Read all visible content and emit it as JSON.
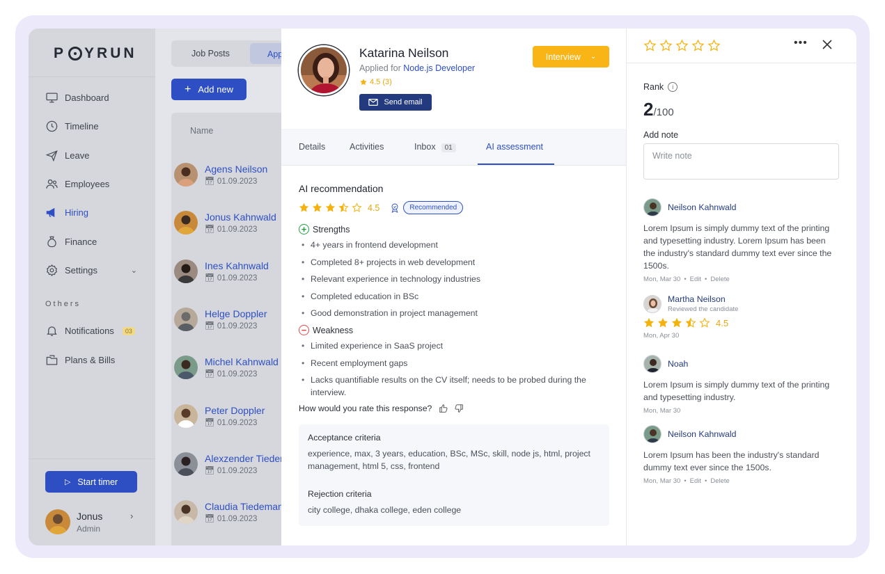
{
  "brand": {
    "logo_text_left": "P",
    "logo_text_right": "YRUN"
  },
  "sidebar": {
    "items": [
      {
        "label": "Dashboard",
        "icon": "monitor-icon"
      },
      {
        "label": "Timeline",
        "icon": "clock-icon"
      },
      {
        "label": "Leave",
        "icon": "plane-icon"
      },
      {
        "label": "Employees",
        "icon": "users-icon"
      },
      {
        "label": "Hiring",
        "icon": "megaphone-icon"
      },
      {
        "label": "Finance",
        "icon": "moneybag-icon"
      },
      {
        "label": "Settings",
        "icon": "gear-icon"
      }
    ],
    "others_label": "Others",
    "others": [
      {
        "label": "Notifications",
        "icon": "bell-icon",
        "badge": "03"
      },
      {
        "label": "Plans & Bills",
        "icon": "folder-icon"
      }
    ],
    "start_timer": "Start timer",
    "user": {
      "name": "Jonus",
      "role": "Admin"
    }
  },
  "list": {
    "tab_job_posts": "Job Posts",
    "tab_applicants": "App",
    "add_new": "Add new",
    "column_name": "Name",
    "candidates": [
      {
        "name": "Agens Neilson",
        "date": "01.09.2023"
      },
      {
        "name": "Jonus Kahnwald",
        "date": "01.09.2023"
      },
      {
        "name": "Ines Kahnwald",
        "date": "01.09.2023"
      },
      {
        "name": "Helge Doppler",
        "date": "01.09.2023"
      },
      {
        "name": "Michel Kahnwald",
        "date": "01.09.2023"
      },
      {
        "name": "Peter Doppler",
        "date": "01.09.2023"
      },
      {
        "name": "Alexzender Tiedemann",
        "date": "01.09.2023"
      },
      {
        "name": "Claudia Tiedemann",
        "date": "01.09.2023"
      }
    ]
  },
  "detail": {
    "name": "Katarina Neilson",
    "applied_prefix": "Applied for",
    "applied_role": "Node.js Developer",
    "rating": "4.5 (3)",
    "send_email": "Send email",
    "status": "Interview",
    "tabs": {
      "details": "Details",
      "activities": "Activities",
      "inbox": "Inbox",
      "inbox_count": "01",
      "ai": "AI assessment"
    },
    "ai": {
      "title": "AI recommendation",
      "score": "4.5",
      "stars": 3.5,
      "badge": "Recommended",
      "strengths_label": "Strengths",
      "strengths": [
        "4+ years in frontend development",
        "Completed 8+ projects in web development",
        "Relevant experience in technology industries",
        "Completed education in BSc",
        "Good demonstration in project management"
      ],
      "weakness_label": "Weakness",
      "weaknesses": [
        "Limited experience in SaaS project",
        "Recent employment gaps",
        "Lacks quantifiable results on the CV itself; needs to be probed during the interview."
      ],
      "rate_question": "How would you rate this response?",
      "acceptance_title": "Acceptance criteria",
      "acceptance_text": "experience, max, 3 years, education, BSc, MSc, skill, node js, html, project management, html 5, css, frontend",
      "rejection_title": "Rejection criteria",
      "rejection_text": "city college, dhaka college, eden college"
    }
  },
  "right": {
    "rank_label": "Rank",
    "rank_value": "2",
    "rank_total": "/100",
    "add_note_label": "Add note",
    "note_placeholder": "Write note",
    "notes": [
      {
        "author": "Neilson Kahnwald",
        "text": "Lorem Ipsum is simply dummy text of the printing and typesetting industry. Lorem Ipsum has been the industry's standard dummy text ever since the 1500s.",
        "date": "Mon, Mar 30",
        "edit": "Edit",
        "delete": "Delete"
      },
      {
        "author": "Martha Neilson",
        "sub": "Reviewed the candidate",
        "score": "4.5",
        "stars": 3.5,
        "date": "Mon, Apr 30"
      },
      {
        "author": "Noah",
        "text": "Lorem Ipsum is simply dummy text of the printing and typesetting industry.",
        "date": "Mon, Mar 30"
      },
      {
        "author": "Neilson Kahnwald",
        "text": "Lorem Ipsum has been the industry's standard dummy text ever since the 1500s.",
        "date": "Mon, Mar 30",
        "edit": "Edit",
        "delete": "Delete"
      }
    ]
  },
  "colors": {
    "primary": "#2d4fc3",
    "star": "#f4b20f",
    "interview": "#f9b416",
    "navy": "#233a7f"
  }
}
